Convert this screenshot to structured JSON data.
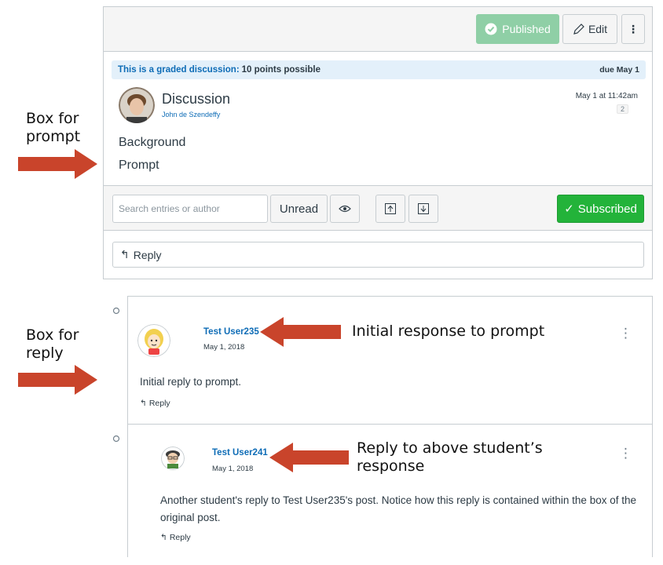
{
  "annotations": {
    "prompt_box": "Box for\nprompt",
    "reply_box": "Box for\nreply",
    "initial_response": "Initial response to prompt",
    "reply_to_response": "Reply to above student’s\nresponse"
  },
  "toolbar": {
    "published_label": "Published",
    "edit_label": "Edit",
    "more_label": "⋮"
  },
  "topic": {
    "graded_lead": "This is a graded discussion:",
    "graded_points": "10 points possible",
    "due": "due May 1",
    "title": "Discussion",
    "author": "John de Szendeffy",
    "timestamp": "May 1 at 11:42am",
    "count": "2",
    "body_line1": "Background",
    "body_line2": "Prompt"
  },
  "filters": {
    "search_placeholder": "Search entries or author",
    "unread_label": "Unread",
    "subscribed_label": "Subscribed"
  },
  "reply_box_label": "Reply",
  "entries": [
    {
      "author": "Test User235",
      "date": "May 1, 2018",
      "message": "Initial reply to prompt.",
      "reply_label": "Reply"
    },
    {
      "author": "Test User241",
      "date": "May 1, 2018",
      "message": "Another student's reply to Test User235's post. Notice how this reply is contained within the box of the original post.",
      "reply_label": "Reply"
    }
  ],
  "colors": {
    "brand_blue": "#0e6cb6",
    "published_green": "#8fcfa6",
    "subscribed_green": "#23b33a",
    "arrow_red": "#c9442b"
  }
}
